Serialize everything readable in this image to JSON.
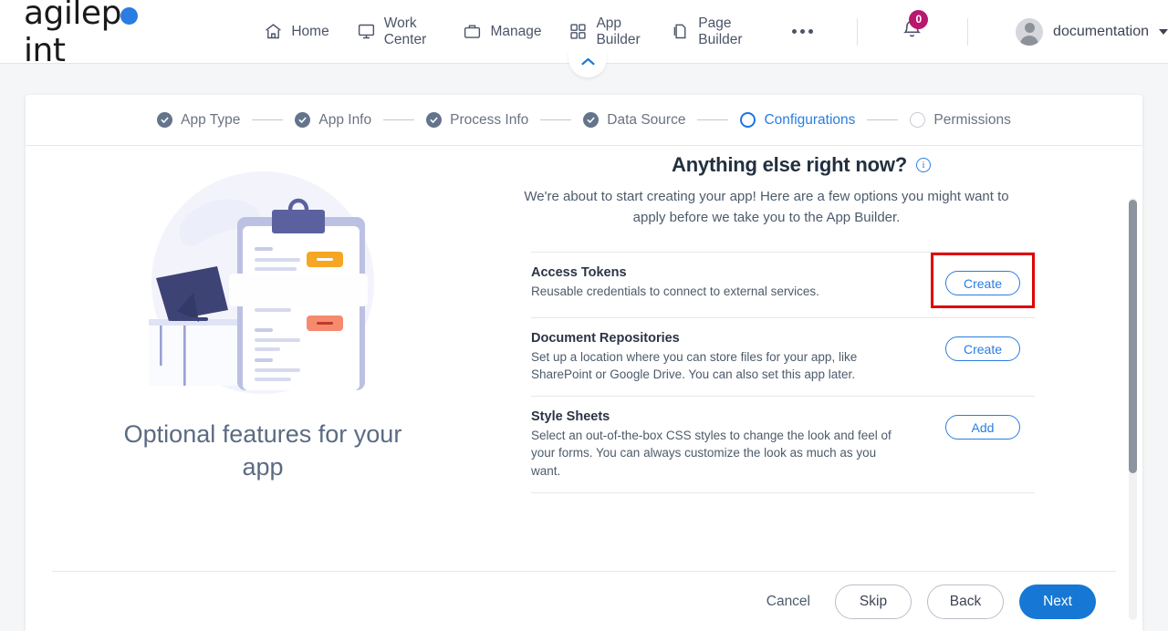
{
  "header": {
    "logo_text_a": "agilep",
    "logo_text_b": "int",
    "nav_items": [
      {
        "label": "Home",
        "icon": "home-icon"
      },
      {
        "label": "Work Center",
        "icon": "monitor-icon"
      },
      {
        "label": "Manage",
        "icon": "briefcase-icon"
      },
      {
        "label": "App Builder",
        "icon": "grid-icon"
      },
      {
        "label": "Page Builder",
        "icon": "pages-icon"
      }
    ],
    "more_label": "More",
    "notification_count": "0",
    "username": "documentation"
  },
  "stepper": {
    "steps": [
      {
        "label": "App Type",
        "state": "done"
      },
      {
        "label": "App Info",
        "state": "done"
      },
      {
        "label": "Process Info",
        "state": "done"
      },
      {
        "label": "Data Source",
        "state": "done"
      },
      {
        "label": "Configurations",
        "state": "active"
      },
      {
        "label": "Permissions",
        "state": "pending"
      }
    ],
    "active_color": "#2a7de1",
    "done_color": "#64748b"
  },
  "left": {
    "caption": "Optional features for your app"
  },
  "main": {
    "title": "Anything else right now?",
    "info_glyph": "i",
    "subtitle": "We're about to start creating your app! Here are a few options you might want to apply before we take you to the App Builder.",
    "options": [
      {
        "name": "Access Tokens",
        "description": "Reusable credentials to connect to external services.",
        "button": "Create",
        "highlighted": true
      },
      {
        "name": "Document Repositories",
        "description": "Set up a location where you can store files for your app, like SharePoint or Google Drive. You can also set this app later.",
        "button": "Create",
        "highlighted": false
      },
      {
        "name": "Style Sheets",
        "description": "Select an out-of-the-box CSS styles to change the look and feel of your forms. You can always customize the look as much as you want.",
        "button": "Add",
        "highlighted": false
      }
    ],
    "highlight_color": "#e20000"
  },
  "footer": {
    "cancel": "Cancel",
    "skip": "Skip",
    "back": "Back",
    "next": "Next",
    "primary_color": "#1678d4"
  }
}
